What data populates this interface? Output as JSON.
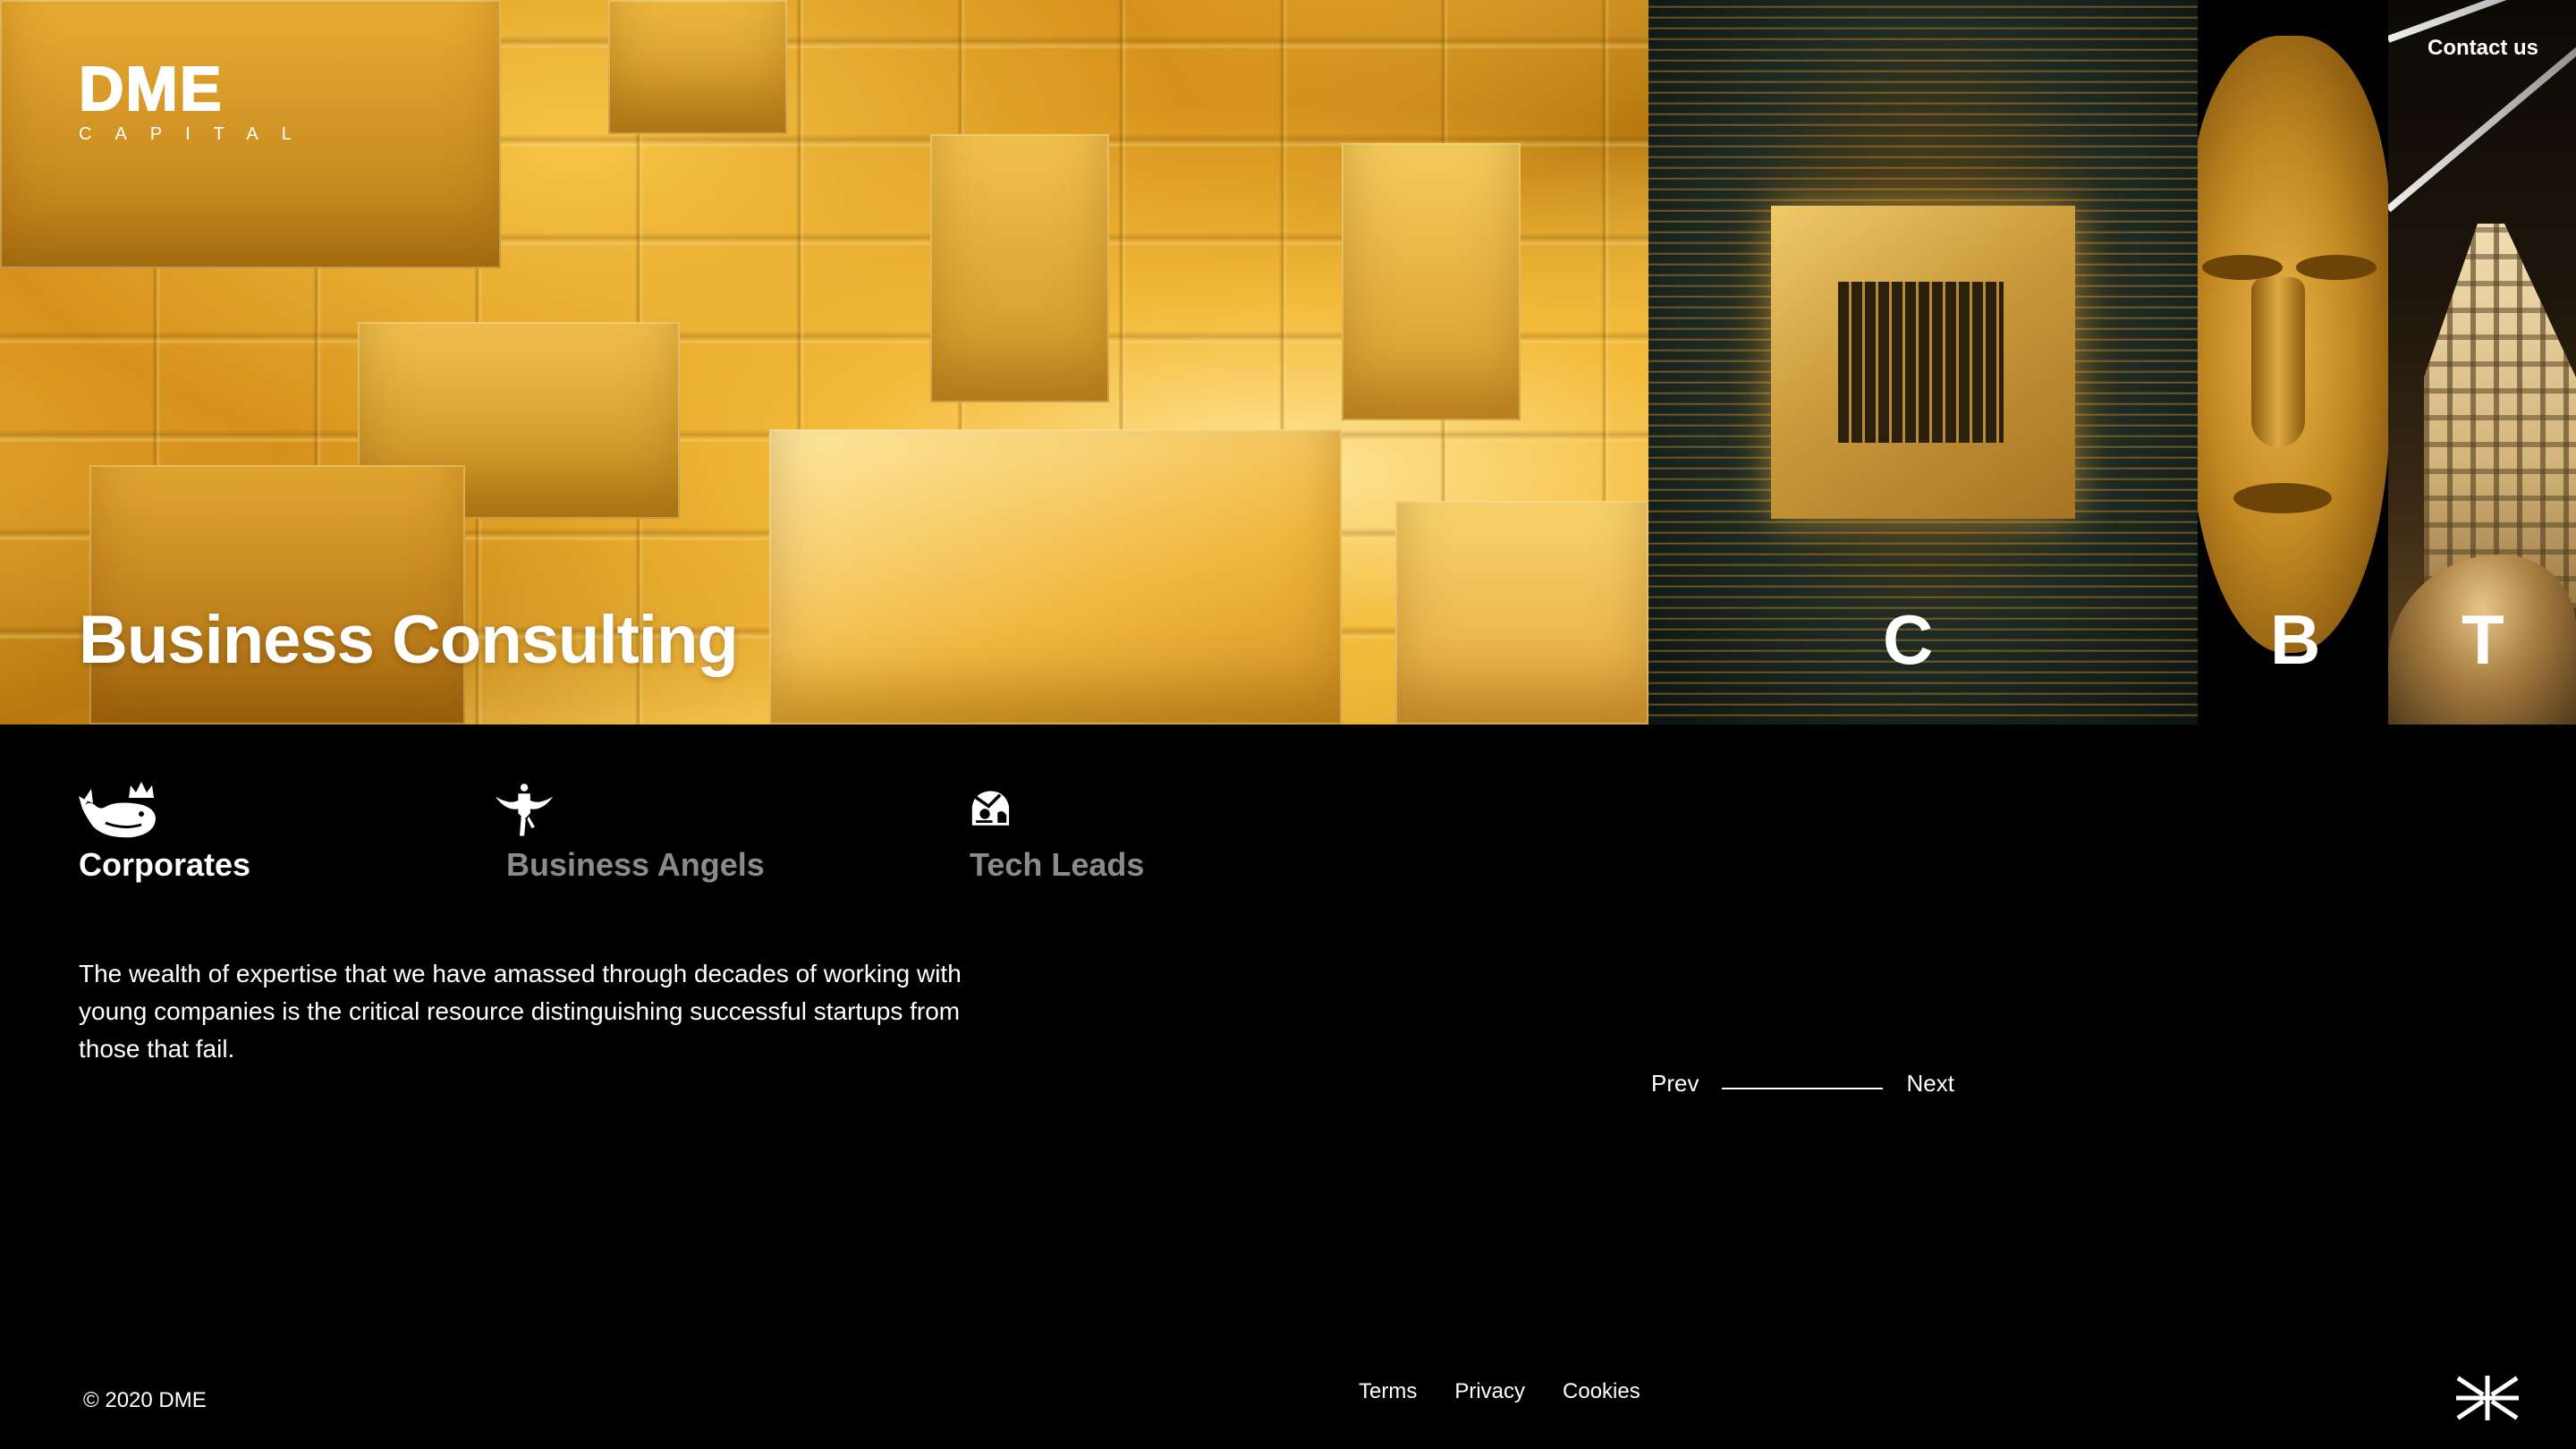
{
  "brand": {
    "name": "DME",
    "sub": "CAPITAL"
  },
  "header": {
    "contact_label": "Contact us"
  },
  "hero": {
    "title": "Business Consulting",
    "panels": [
      "C",
      "B",
      "T"
    ]
  },
  "tabs": [
    {
      "label": "Corporates",
      "icon": "whale-crown-icon",
      "active": true
    },
    {
      "label": "Business Angels",
      "icon": "angel-icon",
      "active": false
    },
    {
      "label": "Tech Leads",
      "icon": "helmet-icon",
      "active": false
    }
  ],
  "description": "The wealth of expertise that we have amassed through decades of working with young companies is the critical resource distinguishing successful startups from those that fail.",
  "pager": {
    "prev_label": "Prev",
    "next_label": "Next"
  },
  "footer": {
    "copyright": "© 2020 DME",
    "links": [
      "Terms",
      "Privacy",
      "Cookies"
    ],
    "language_icon": "uk-flag-icon"
  },
  "colors": {
    "background": "#000000",
    "text": "#ffffff",
    "inactive_tab": "#8b8b8b",
    "gold": "#e6ad35"
  }
}
